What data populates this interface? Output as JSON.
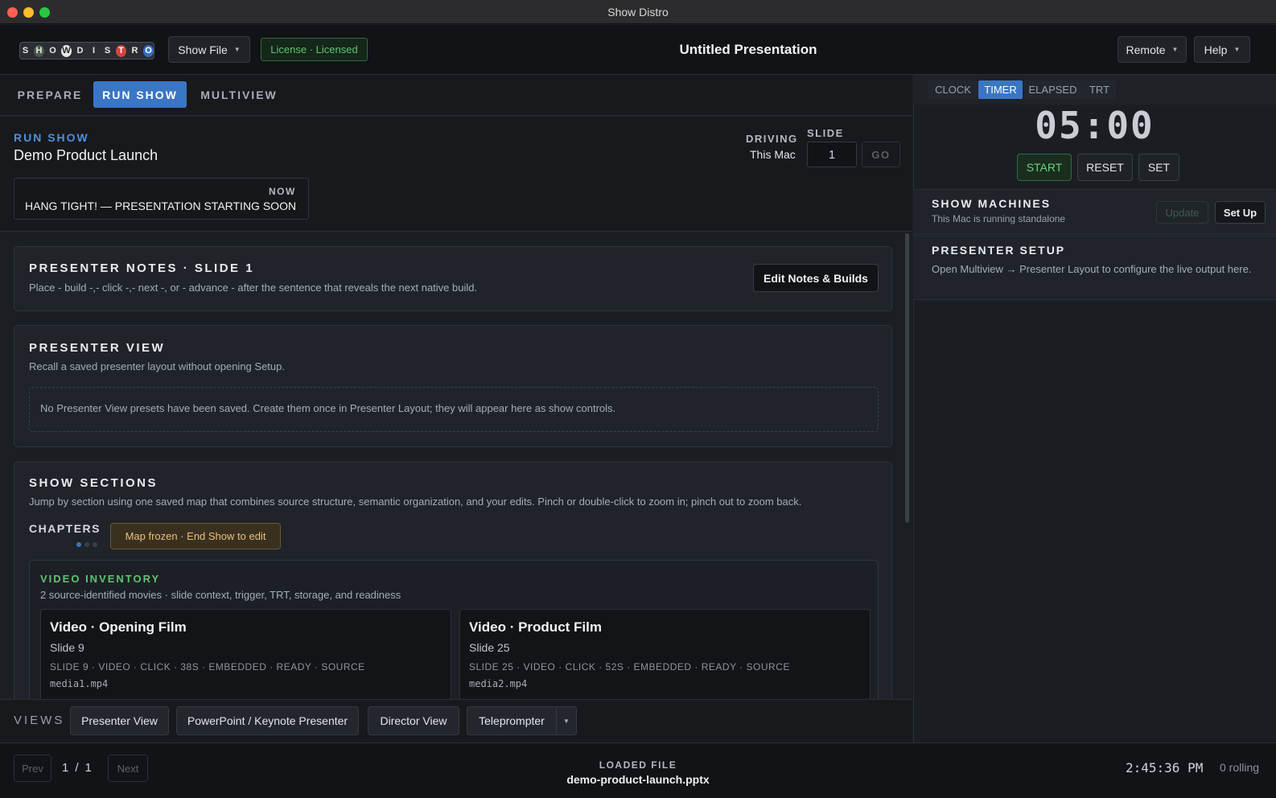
{
  "window": {
    "title": "Show Distro"
  },
  "logo": {
    "letters": [
      "S",
      "H",
      "O",
      "W",
      "D",
      "I",
      "S",
      "T",
      "R",
      "O"
    ]
  },
  "header": {
    "show_file": "Show File",
    "license": "License · Licensed",
    "doc_title": "Untitled Presentation",
    "remote": "Remote",
    "help": "Help"
  },
  "tabs": {
    "prepare": "PREPARE",
    "run_show": "RUN SHOW",
    "multiview": "MULTIVIEW"
  },
  "run": {
    "label": "RUN SHOW",
    "show_name": "Demo Product Launch",
    "now_label": "NOW",
    "now_text": "HANG TIGHT! — PRESENTATION STARTING SOON",
    "driving_label": "DRIVING",
    "driving_value": "This Mac",
    "slide_label": "SLIDE",
    "slide_value": "1",
    "go": "GO"
  },
  "notes": {
    "title": "PRESENTER NOTES · SLIDE 1",
    "text": "Place - build -,- click -,- next -, or - advance - after the sentence that reveals the next native build.",
    "button": "Edit Notes & Builds"
  },
  "presenter_view": {
    "title": "PRESENTER VIEW",
    "subtitle": "Recall a saved presenter layout without opening Setup.",
    "empty": "No Presenter View presets have been saved. Create them once in Presenter Layout; they will appear here as show controls."
  },
  "sections": {
    "title": "SHOW SECTIONS",
    "subtitle": "Jump by section using one saved map that combines source structure, semantic organization, and your edits. Pinch or double-click to zoom in; pinch out to zoom back.",
    "chapters": "CHAPTERS",
    "frozen": "Map frozen · End Show to edit",
    "inventory_title": "VIDEO INVENTORY",
    "inventory_sub": "2 source-identified movies · slide context, trigger, TRT, storage, and readiness",
    "videos": [
      {
        "title": "Video · Opening Film",
        "slide": "Slide 9",
        "meta": "SLIDE 9 · VIDEO · CLICK · 38S · EMBEDDED · READY · SOURCE",
        "file": "media1.mp4"
      },
      {
        "title": "Video · Product Film",
        "slide": "Slide 25",
        "meta": "SLIDE 25 · VIDEO · CLICK · 52S · EMBEDDED · READY · SOURCE",
        "file": "media2.mp4"
      }
    ]
  },
  "views": {
    "label": "VIEWS",
    "items": [
      "Presenter View",
      "PowerPoint / Keynote Presenter",
      "Director View",
      "Teleprompter"
    ]
  },
  "footer": {
    "prev": "Prev",
    "page": "1",
    "sep": "/",
    "total": "1",
    "next": "Next",
    "loaded_label": "LOADED FILE",
    "loaded_file": "demo-product-launch.pptx",
    "time": "2:45:36 PM",
    "rolling": "0 rolling"
  },
  "timer": {
    "tabs": [
      "CLOCK",
      "TIMER",
      "ELAPSED",
      "TRT"
    ],
    "display": "05:00",
    "start": "START",
    "reset": "RESET",
    "set": "SET"
  },
  "machines": {
    "title": "SHOW MACHINES",
    "status": "This Mac is running standalone",
    "update": "Update",
    "setup": "Set Up"
  },
  "presenter_setup": {
    "title": "PRESENTER SETUP",
    "text": "Open Multiview → Presenter Layout to configure the live output here."
  },
  "colors": {
    "accent": "#3a76c4",
    "success": "#5fc46f",
    "warning": "#e7c27a",
    "background": "#1b1e23"
  }
}
